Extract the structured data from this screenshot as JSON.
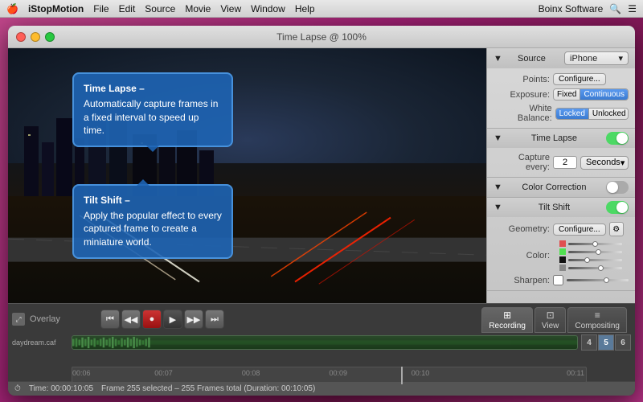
{
  "menubar": {
    "apple": "🍎",
    "appName": "iStopMotion",
    "menus": [
      "File",
      "Edit",
      "Source",
      "Movie",
      "View",
      "Window",
      "Help"
    ],
    "rightText": "Boinx Software",
    "searchIcon": "🔍",
    "listIcon": "☰"
  },
  "titleBar": {
    "text": "Time Lapse @ 100%",
    "closeBtn": "×",
    "minBtn": "−",
    "maxBtn": "+"
  },
  "tooltips": {
    "top": {
      "title": "Time Lapse –",
      "body": "Automatically capture frames in a fixed interval to speed up time."
    },
    "bottom": {
      "title": "Tilt Shift –",
      "body": "Apply the popular effect to every captured frame to create a miniature world."
    }
  },
  "rightPanel": {
    "source": {
      "label": "Source",
      "device": "iPhone",
      "pointsLabel": "Points:",
      "configureBtn": "Configure...",
      "exposureLabel": "Exposure:",
      "exposureFixed": "Fixed",
      "exposureContinuous": "Continuous",
      "whiteBalanceLabel": "White Balance:",
      "wbLocked": "Locked",
      "wbUnlocked": "Unlocked"
    },
    "timeLapse": {
      "label": "Time Lapse",
      "captureEveryLabel": "Capture every:",
      "captureValue": "2",
      "captureUnit": "Seconds"
    },
    "colorCorrection": {
      "label": "Color Correction"
    },
    "tiltShift": {
      "label": "Tilt Shift",
      "geometryLabel": "Geometry:",
      "configureBtnLabel": "Configure...",
      "colorLabel": "Color:",
      "sharpenLabel": "Sharpen:"
    }
  },
  "transport": {
    "tabs": [
      "Recording",
      "View",
      "Compositing"
    ],
    "overlayLabel": "Overlay",
    "frameLabel": "Frame 255 selected – 255 Frames total (Duration: 00:10:05)"
  },
  "timeline": {
    "trackLabel": "daydream.caf",
    "timeMarkers": [
      "00:06",
      "00:07",
      "00:08",
      "00:09",
      "00:10",
      "00:11"
    ],
    "frameNumbers": [
      "4",
      "5",
      "6"
    ],
    "highlightFrame": 1
  },
  "statusBar": {
    "icon": "⏱",
    "timeCode": "Time: 00:00:10:05",
    "frameInfo": "Frame 255 selected – 255 Frames total (Duration: 00:10:05)"
  }
}
